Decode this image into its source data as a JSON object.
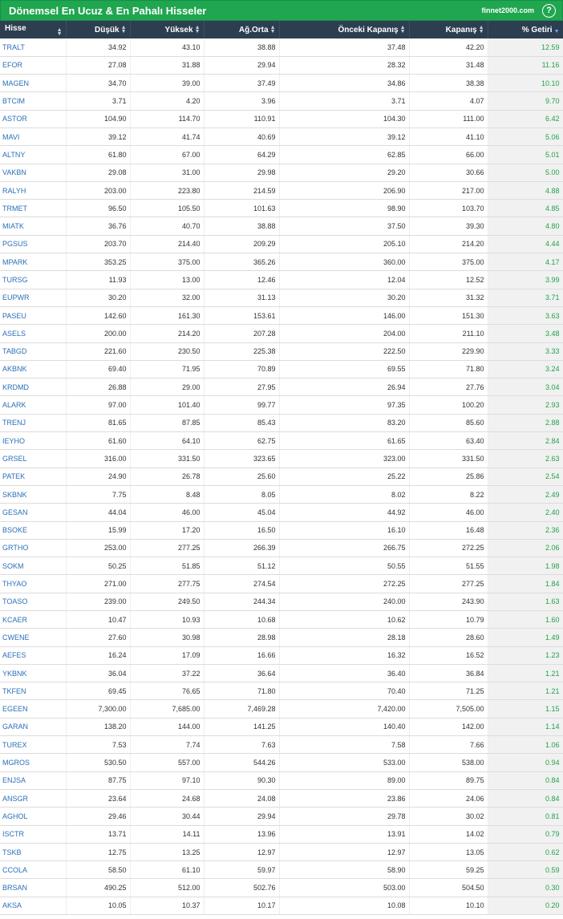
{
  "header": {
    "title": "Dönemsel En Ucuz & En Pahalı Hisseler",
    "brand": "finnet2000.com",
    "help_glyph": "?"
  },
  "colors": {
    "title_bg": "#1fa64f",
    "header_bg": "#2d3e50",
    "symbol_link": "#2a6fb7",
    "positive": "#22a24b"
  },
  "table": {
    "columns": [
      "Hisse",
      "Düşük",
      "Yüksek",
      "Ağ.Orta",
      "Önceki Kapanış",
      "Kapanış",
      "% Getiri"
    ],
    "sort": {
      "column": "% Getiri",
      "direction": "desc"
    },
    "rows": [
      [
        "TRALT",
        "34.92",
        "43.10",
        "38.88",
        "37.48",
        "42.20",
        "12.59"
      ],
      [
        "EFOR",
        "27.08",
        "31.88",
        "29.94",
        "28.32",
        "31.48",
        "11.16"
      ],
      [
        "MAGEN",
        "34.70",
        "39.00",
        "37.49",
        "34.86",
        "38.38",
        "10.10"
      ],
      [
        "BTCIM",
        "3.71",
        "4.20",
        "3.96",
        "3.71",
        "4.07",
        "9.70"
      ],
      [
        "ASTOR",
        "104.90",
        "114.70",
        "110.91",
        "104.30",
        "111.00",
        "6.42"
      ],
      [
        "MAVI",
        "39.12",
        "41.74",
        "40.69",
        "39.12",
        "41.10",
        "5.06"
      ],
      [
        "ALTNY",
        "61.80",
        "67.00",
        "64.29",
        "62.85",
        "66.00",
        "5.01"
      ],
      [
        "VAKBN",
        "29.08",
        "31.00",
        "29.98",
        "29.20",
        "30.66",
        "5.00"
      ],
      [
        "RALYH",
        "203.00",
        "223.80",
        "214.59",
        "206.90",
        "217.00",
        "4.88"
      ],
      [
        "TRMET",
        "96.50",
        "105.50",
        "101.63",
        "98.90",
        "103.70",
        "4.85"
      ],
      [
        "MIATK",
        "36.76",
        "40.70",
        "38.88",
        "37.50",
        "39.30",
        "4.80"
      ],
      [
        "PGSUS",
        "203.70",
        "214.40",
        "209.29",
        "205.10",
        "214.20",
        "4.44"
      ],
      [
        "MPARK",
        "353.25",
        "375.00",
        "365.26",
        "360.00",
        "375.00",
        "4.17"
      ],
      [
        "TURSG",
        "11.93",
        "13.00",
        "12.46",
        "12.04",
        "12.52",
        "3.99"
      ],
      [
        "EUPWR",
        "30.20",
        "32.00",
        "31.13",
        "30.20",
        "31.32",
        "3.71"
      ],
      [
        "PASEU",
        "142.60",
        "161.30",
        "153.61",
        "146.00",
        "151.30",
        "3.63"
      ],
      [
        "ASELS",
        "200.00",
        "214.20",
        "207.28",
        "204.00",
        "211.10",
        "3.48"
      ],
      [
        "TABGD",
        "221.60",
        "230.50",
        "225.38",
        "222.50",
        "229.90",
        "3.33"
      ],
      [
        "AKBNK",
        "69.40",
        "71.95",
        "70.89",
        "69.55",
        "71.80",
        "3.24"
      ],
      [
        "KRDMD",
        "26.88",
        "29.00",
        "27.95",
        "26.94",
        "27.76",
        "3.04"
      ],
      [
        "ALARK",
        "97.00",
        "101.40",
        "99.77",
        "97.35",
        "100.20",
        "2.93"
      ],
      [
        "TRENJ",
        "81.65",
        "87.85",
        "85.43",
        "83.20",
        "85.60",
        "2.88"
      ],
      [
        "IEYHO",
        "61.60",
        "64.10",
        "62.75",
        "61.65",
        "63.40",
        "2.84"
      ],
      [
        "GRSEL",
        "316.00",
        "331.50",
        "323.65",
        "323.00",
        "331.50",
        "2.63"
      ],
      [
        "PATEK",
        "24.90",
        "26.78",
        "25.60",
        "25.22",
        "25.86",
        "2.54"
      ],
      [
        "SKBNK",
        "7.75",
        "8.48",
        "8.05",
        "8.02",
        "8.22",
        "2.49"
      ],
      [
        "GESAN",
        "44.04",
        "46.00",
        "45.04",
        "44.92",
        "46.00",
        "2.40"
      ],
      [
        "BSOKE",
        "15.99",
        "17.20",
        "16.50",
        "16.10",
        "16.48",
        "2.36"
      ],
      [
        "GRTHO",
        "253.00",
        "277.25",
        "266.39",
        "266.75",
        "272.25",
        "2.06"
      ],
      [
        "SOKM",
        "50.25",
        "51.85",
        "51.12",
        "50.55",
        "51.55",
        "1.98"
      ],
      [
        "THYAO",
        "271.00",
        "277.75",
        "274.54",
        "272.25",
        "277.25",
        "1.84"
      ],
      [
        "TOASO",
        "239.00",
        "249.50",
        "244.34",
        "240.00",
        "243.90",
        "1.63"
      ],
      [
        "KCAER",
        "10.47",
        "10.93",
        "10.68",
        "10.62",
        "10.79",
        "1.60"
      ],
      [
        "CWENE",
        "27.60",
        "30.98",
        "28.98",
        "28.18",
        "28.60",
        "1.49"
      ],
      [
        "AEFES",
        "16.24",
        "17.09",
        "16.66",
        "16.32",
        "16.52",
        "1.23"
      ],
      [
        "YKBNK",
        "36.04",
        "37.22",
        "36.64",
        "36.40",
        "36.84",
        "1.21"
      ],
      [
        "TKFEN",
        "69.45",
        "76.65",
        "71.80",
        "70.40",
        "71.25",
        "1.21"
      ],
      [
        "EGEEN",
        "7,300.00",
        "7,685.00",
        "7,469.28",
        "7,420.00",
        "7,505.00",
        "1.15"
      ],
      [
        "GARAN",
        "138.20",
        "144.00",
        "141.25",
        "140.40",
        "142.00",
        "1.14"
      ],
      [
        "TUREX",
        "7.53",
        "7.74",
        "7.63",
        "7.58",
        "7.66",
        "1.06"
      ],
      [
        "MGROS",
        "530.50",
        "557.00",
        "544.26",
        "533.00",
        "538.00",
        "0.94"
      ],
      [
        "ENJSA",
        "87.75",
        "97.10",
        "90.30",
        "89.00",
        "89.75",
        "0.84"
      ],
      [
        "ANSGR",
        "23.64",
        "24.68",
        "24.08",
        "23.86",
        "24.06",
        "0.84"
      ],
      [
        "AGHOL",
        "29.46",
        "30.44",
        "29.94",
        "29.78",
        "30.02",
        "0.81"
      ],
      [
        "ISCTR",
        "13.71",
        "14.11",
        "13.96",
        "13.91",
        "14.02",
        "0.79"
      ],
      [
        "TSKB",
        "12.75",
        "13.25",
        "12.97",
        "12.97",
        "13.05",
        "0.62"
      ],
      [
        "CCOLA",
        "58.50",
        "61.10",
        "59.97",
        "58.90",
        "59.25",
        "0.59"
      ],
      [
        "BRSAN",
        "490.25",
        "512.00",
        "502.76",
        "503.00",
        "504.50",
        "0.30"
      ],
      [
        "AKSA",
        "10.05",
        "10.37",
        "10.17",
        "10.08",
        "10.10",
        "0.20"
      ]
    ]
  }
}
